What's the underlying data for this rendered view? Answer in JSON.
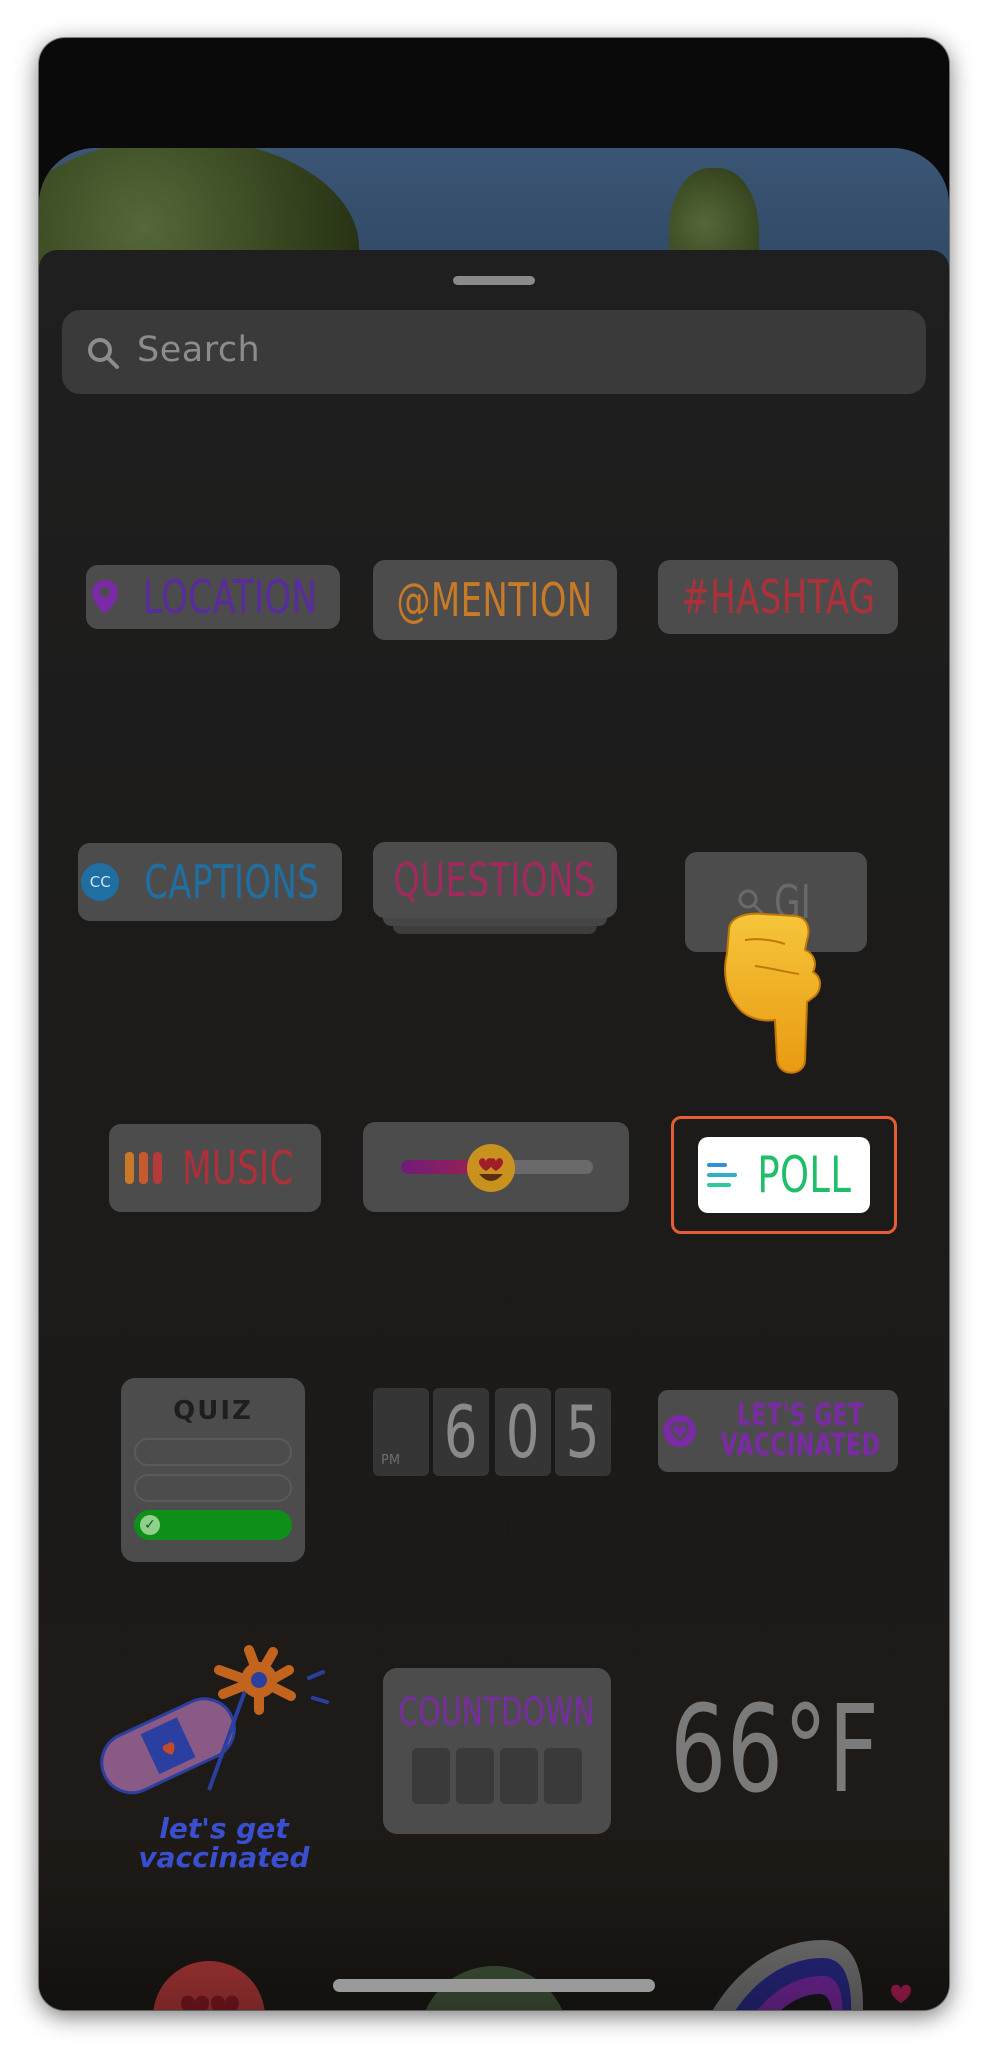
{
  "search": {
    "placeholder": "Search"
  },
  "stickers": {
    "location": "LOCATION",
    "mention": "@MENTION",
    "hashtag": "#HASHTAG",
    "captions": "CAPTIONS",
    "captions_badge": "CC",
    "questions": "QUESTIONS",
    "gif_partial": "GI",
    "music": "MUSIC",
    "poll": "POLL",
    "quiz": "QUIZ",
    "clock": {
      "period": "PM",
      "h": "6",
      "m1": "0",
      "m2": "5"
    },
    "vaccinated_1": "LET'S GET",
    "vaccinated_2": "VACCINATED",
    "lets_get_1": "let's get",
    "lets_get_2": "vaccinated",
    "countdown": "COUNTDOWN",
    "weather": "66°F"
  },
  "icons": {
    "search": "search-icon",
    "location_pin": "map-pin-icon",
    "pointer": "pointing-down-hand-icon",
    "poll_bars": "poll-lines-icon"
  },
  "colors": {
    "poll_highlight": "#e45d34",
    "poll_text": "#1fbf6a",
    "quiz_correct": "#0d8f1a"
  }
}
